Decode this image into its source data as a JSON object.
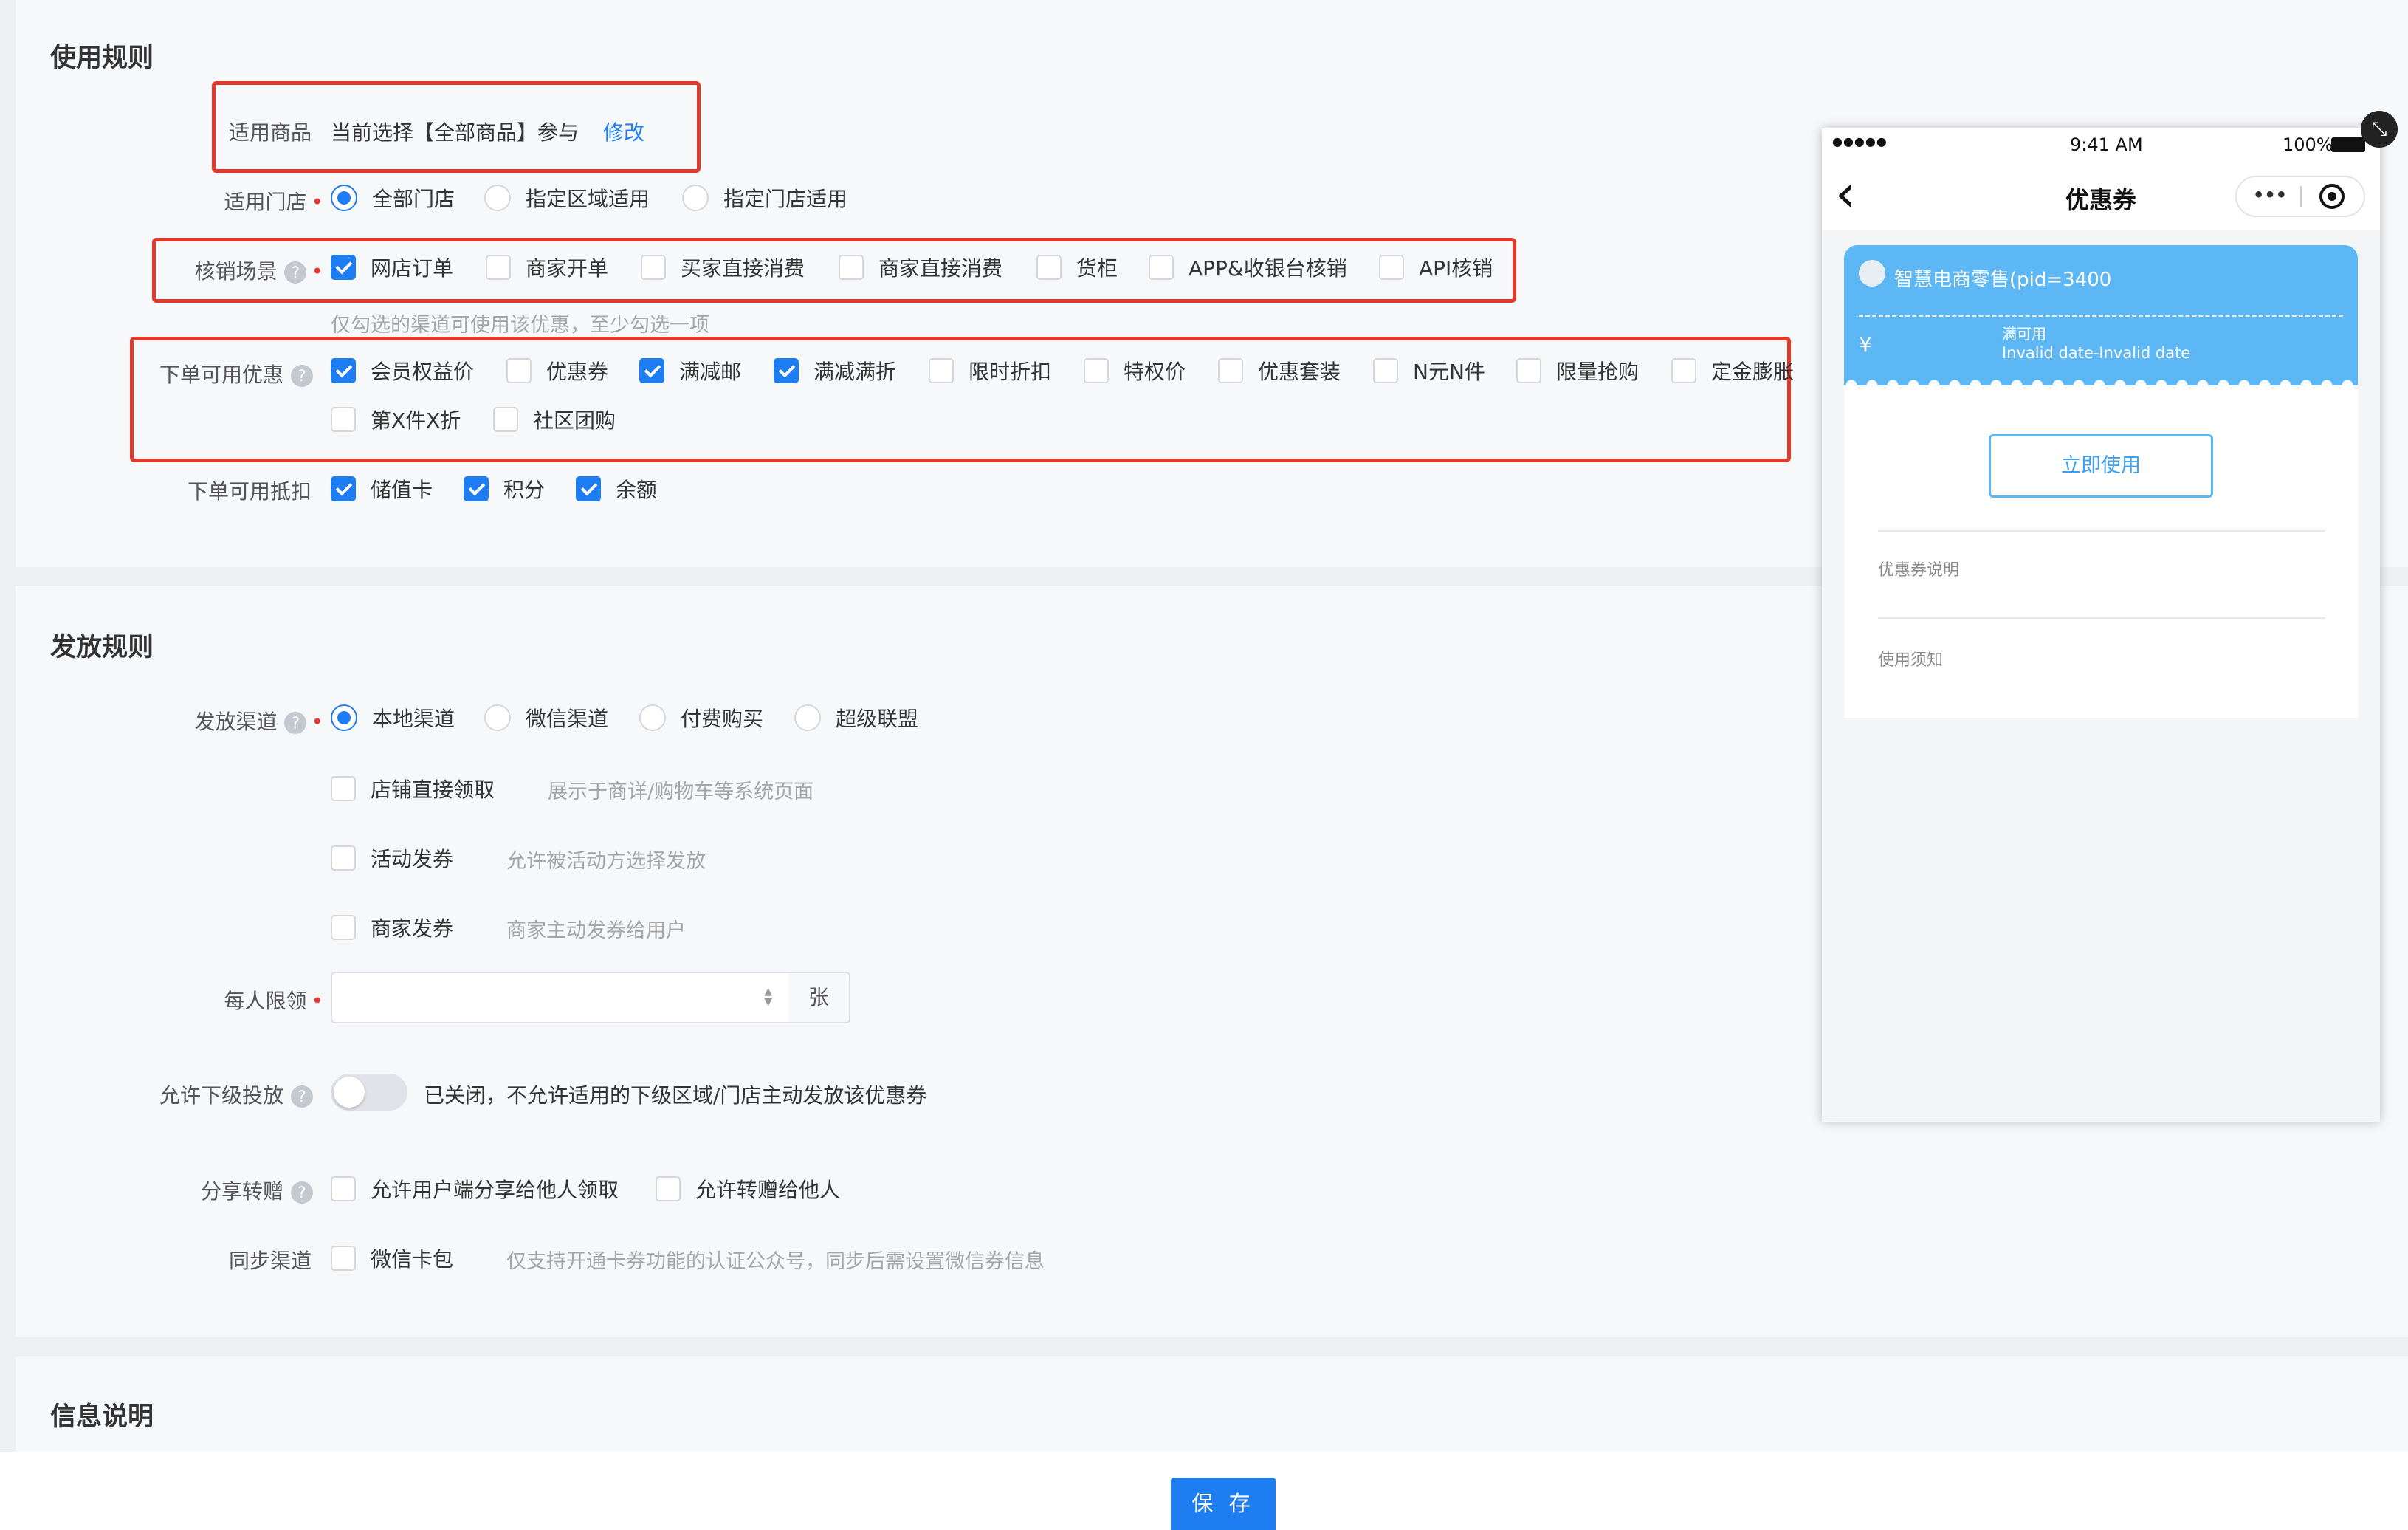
{
  "usage_rules": {
    "title": "使用规则",
    "applicable_goods": {
      "label": "适用商品",
      "value": "当前选择【全部商品】参与",
      "edit": "修改"
    },
    "applicable_stores": {
      "label": "适用门店",
      "options": [
        "全部门店",
        "指定区域适用",
        "指定门店适用"
      ],
      "selected": 0
    },
    "writeoff_scene": {
      "label": "核销场景",
      "options": [
        "网店订单",
        "商家开单",
        "买家直接消费",
        "商家直接消费",
        "货柜",
        "APP&收银台核销",
        "API核销"
      ],
      "checked": [
        true,
        false,
        false,
        false,
        false,
        false,
        false
      ],
      "hint": "仅勾选的渠道可使用该优惠，至少勾选一项"
    },
    "order_discounts": {
      "label": "下单可用优惠",
      "options_row1": [
        "会员权益价",
        "优惠券",
        "满减邮",
        "满减满折",
        "限时折扣",
        "特权价",
        "优惠套装",
        "N元N件",
        "限量抢购",
        "定金膨胀"
      ],
      "checked_row1": [
        true,
        false,
        true,
        true,
        false,
        false,
        false,
        false,
        false,
        false
      ],
      "options_row2": [
        "第X件X折",
        "社区团购"
      ],
      "checked_row2": [
        false,
        false
      ]
    },
    "order_deductions": {
      "label": "下单可用抵扣",
      "options": [
        "储值卡",
        "积分",
        "余额"
      ],
      "checked": [
        true,
        true,
        true
      ]
    }
  },
  "issue_rules": {
    "title": "发放规则",
    "channel": {
      "label": "发放渠道",
      "options": [
        "本地渠道",
        "微信渠道",
        "付费购买",
        "超级联盟"
      ],
      "selected": 0
    },
    "sub_options": [
      {
        "label": "店铺直接领取",
        "hint": "展示于商详/购物车等系统页面",
        "checked": false
      },
      {
        "label": "活动发券",
        "hint": "允许被活动方选择发放",
        "checked": false
      },
      {
        "label": "商家发券",
        "hint": "商家主动发券给用户",
        "checked": false
      }
    ],
    "per_person_limit": {
      "label": "每人限领",
      "value": "",
      "unit": "张"
    },
    "allow_sub_delivery": {
      "label": "允许下级投放",
      "status": "已关闭，不允许适用的下级区域/门店主动发放该优惠券",
      "on": false
    },
    "share_transfer": {
      "label": "分享转赠",
      "options": [
        "允许用户端分享给他人领取",
        "允许转赠给他人"
      ],
      "checked": [
        false,
        false
      ]
    },
    "sync_channel": {
      "label": "同步渠道",
      "option": "微信卡包",
      "checked": false,
      "hint": "仅支持开通卡券功能的认证公众号，同步后需设置微信券信息"
    }
  },
  "info_section": {
    "title": "信息说明"
  },
  "footer": {
    "save": "保 存"
  },
  "phone": {
    "status_time": "9:41 AM",
    "battery": "100%",
    "nav_title": "优惠券",
    "capsule_more": "•••",
    "coupon": {
      "shop_name": "智慧电商零售(pid=3400",
      "currency": "¥",
      "condition": "满可用",
      "validity": "Invalid date-Invalid date",
      "use_now": "立即使用",
      "desc_label": "优惠券说明",
      "notice_label": "使用须知"
    }
  },
  "icons": {
    "help": "?",
    "back": "‹",
    "shrink": "⤡",
    "signal": "●●●●●",
    "spin_up": "▲",
    "spin_down": "▼"
  },
  "colors": {
    "primary": "#1e7df0",
    "highlight_box": "#e3392b",
    "coupon": "#5eb7f5"
  }
}
